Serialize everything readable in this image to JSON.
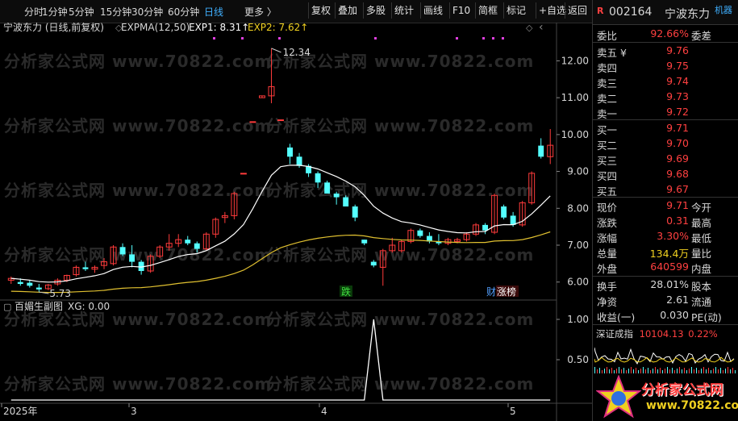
{
  "toolbar": {
    "periods": [
      "分时",
      "1分钟",
      "5分钟",
      "15分钟",
      "30分钟",
      "60分钟",
      "日线",
      "更多 〉"
    ],
    "active_period": "日线",
    "buttons": [
      "复权",
      "叠加",
      "多股",
      "统计",
      "画线",
      "F10",
      "简框",
      "标记",
      "+自选",
      "返回"
    ]
  },
  "chart": {
    "stock_title": "宁波东力 (日线,前复权)",
    "indicator_name": "EXPMA(12,50)",
    "exp1_label": "EXP1: 8.31↑",
    "exp2_label": "EXP2: 7.62↑",
    "high_marker": "12.34",
    "low_marker": "5.73",
    "y_ticks": [
      "12.00",
      "11.00",
      "10.00",
      "9.00",
      "8.00",
      "7.00",
      "6.00"
    ],
    "sub_title": "百媚生副图",
    "sub_value": "XG: 0.00",
    "sub_y_ticks": [
      "1.00",
      "0.50"
    ],
    "x_labels": [
      "2025年",
      "3",
      "4",
      "5"
    ],
    "tag_fall": "跌",
    "tag_fin": "财",
    "tag_limit": "涨榜"
  },
  "chart_data": {
    "type": "candlestick",
    "ylim": [
      5.6,
      12.6
    ],
    "candles": [
      [
        6.05,
        6.15,
        5.95,
        6.1
      ],
      [
        6.0,
        6.1,
        5.9,
        5.95
      ],
      [
        5.98,
        6.05,
        5.85,
        5.9
      ],
      [
        5.85,
        5.95,
        5.73,
        5.8
      ],
      [
        5.82,
        5.95,
        5.78,
        5.92
      ],
      [
        5.95,
        6.1,
        5.9,
        6.05
      ],
      [
        6.05,
        6.2,
        6.0,
        6.18
      ],
      [
        6.2,
        6.45,
        6.15,
        6.4
      ],
      [
        6.4,
        6.55,
        6.3,
        6.35
      ],
      [
        6.35,
        6.45,
        6.25,
        6.4
      ],
      [
        6.45,
        6.65,
        6.35,
        6.55
      ],
      [
        6.5,
        7.0,
        6.45,
        6.95
      ],
      [
        6.95,
        7.05,
        6.7,
        6.75
      ],
      [
        6.75,
        7.0,
        6.4,
        6.55
      ],
      [
        6.55,
        6.6,
        6.2,
        6.3
      ],
      [
        6.3,
        6.75,
        6.25,
        6.7
      ],
      [
        6.7,
        7.0,
        6.65,
        6.95
      ],
      [
        6.95,
        7.3,
        6.85,
        7.05
      ],
      [
        7.05,
        7.3,
        6.95,
        7.15
      ],
      [
        7.15,
        7.25,
        7.0,
        7.05
      ],
      [
        7.05,
        7.1,
        6.8,
        6.9
      ],
      [
        6.9,
        7.35,
        6.85,
        7.3
      ],
      [
        7.3,
        7.75,
        7.2,
        7.7
      ],
      [
        7.75,
        7.9,
        7.6,
        7.8
      ],
      [
        7.8,
        8.45,
        7.7,
        8.4
      ],
      [
        8.95,
        8.95,
        8.95,
        8.95
      ],
      [
        10.35,
        10.35,
        10.35,
        10.35
      ],
      [
        11.0,
        11.05,
        11.0,
        11.05
      ],
      [
        11.05,
        12.34,
        10.85,
        11.3
      ],
      [
        10.4,
        10.4,
        10.4,
        10.4
      ],
      [
        9.65,
        9.75,
        9.2,
        9.4
      ],
      [
        9.4,
        9.5,
        9.1,
        9.15
      ],
      [
        9.15,
        9.2,
        8.85,
        8.95
      ],
      [
        8.95,
        9.0,
        8.55,
        8.7
      ],
      [
        8.7,
        8.75,
        8.4,
        8.4
      ],
      [
        8.4,
        8.45,
        8.1,
        8.3
      ],
      [
        8.3,
        8.35,
        8.05,
        8.05
      ],
      [
        8.05,
        8.1,
        7.65,
        7.75
      ],
      [
        7.15,
        7.15,
        7.0,
        7.05
      ],
      [
        6.55,
        6.6,
        6.4,
        6.45
      ],
      [
        6.4,
        6.9,
        5.9,
        6.85
      ],
      [
        6.85,
        7.2,
        6.8,
        7.0
      ],
      [
        6.85,
        7.15,
        6.8,
        7.1
      ],
      [
        7.1,
        7.45,
        7.05,
        7.4
      ],
      [
        7.4,
        7.45,
        7.2,
        7.25
      ],
      [
        7.25,
        7.35,
        7.05,
        7.1
      ],
      [
        7.1,
        7.3,
        7.0,
        7.05
      ],
      [
        7.05,
        7.2,
        7.0,
        7.15
      ],
      [
        7.1,
        7.2,
        7.05,
        7.15
      ],
      [
        7.15,
        7.35,
        7.1,
        7.3
      ],
      [
        7.3,
        7.6,
        7.25,
        7.55
      ],
      [
        7.55,
        7.6,
        7.3,
        7.4
      ],
      [
        7.35,
        8.4,
        7.3,
        8.35
      ],
      [
        8.05,
        8.1,
        7.7,
        7.75
      ],
      [
        7.8,
        7.9,
        7.5,
        7.55
      ],
      [
        7.55,
        8.2,
        7.5,
        8.15
      ],
      [
        8.15,
        9.0,
        8.1,
        8.95
      ],
      [
        9.7,
        9.9,
        9.35,
        9.4
      ],
      [
        9.4,
        10.15,
        9.2,
        9.71
      ]
    ],
    "xg_signal_index": 39
  },
  "quote": {
    "badge": "R",
    "code": "002164",
    "name": "宁波东力",
    "machine": "机器",
    "webi_label": "委比",
    "webi_value": "92.66%",
    "weicha_label": "委差",
    "sells": [
      {
        "label": "卖五 ¥",
        "price": "9.76"
      },
      {
        "label": "卖四",
        "price": "9.75"
      },
      {
        "label": "卖三",
        "price": "9.74"
      },
      {
        "label": "卖二",
        "price": "9.73"
      },
      {
        "label": "卖一",
        "price": "9.72"
      }
    ],
    "buys": [
      {
        "label": "买一",
        "price": "9.71"
      },
      {
        "label": "买二",
        "price": "9.70"
      },
      {
        "label": "买三",
        "price": "9.69"
      },
      {
        "label": "买四",
        "price": "9.68"
      },
      {
        "label": "买五",
        "price": "9.67"
      }
    ],
    "stats": [
      {
        "label": "现价",
        "value": "9.71",
        "right": "今开"
      },
      {
        "label": "涨跌",
        "value": "0.31",
        "right": "最高"
      },
      {
        "label": "涨幅",
        "value": "3.30%",
        "right": "最低"
      },
      {
        "label": "总量",
        "value": "134.4万",
        "right": "量比"
      },
      {
        "label": "外盘",
        "value": "640599",
        "right": "内盘"
      }
    ],
    "stats2": [
      {
        "label": "换手",
        "value": "28.01%",
        "right": "股本"
      },
      {
        "label": "净资",
        "value": "2.61",
        "right": "流通"
      },
      {
        "label": "收益(一)",
        "value": "0.030",
        "right": "PE(动)"
      }
    ],
    "index_name": "深证成指",
    "index_value": "10104.13",
    "index_change": "0.22%"
  },
  "watermark": {
    "text": "分析家公式网 www.70822.com",
    "logo_text": "分析家公式网",
    "logo_url": "www.70822.com"
  },
  "colors": {
    "up": "#ff3b3b",
    "down": "#54ffff",
    "exp1": "#ffffff",
    "exp2": "#e0c030",
    "accent": "#3fb0ff",
    "magenta": "#e040e0"
  }
}
